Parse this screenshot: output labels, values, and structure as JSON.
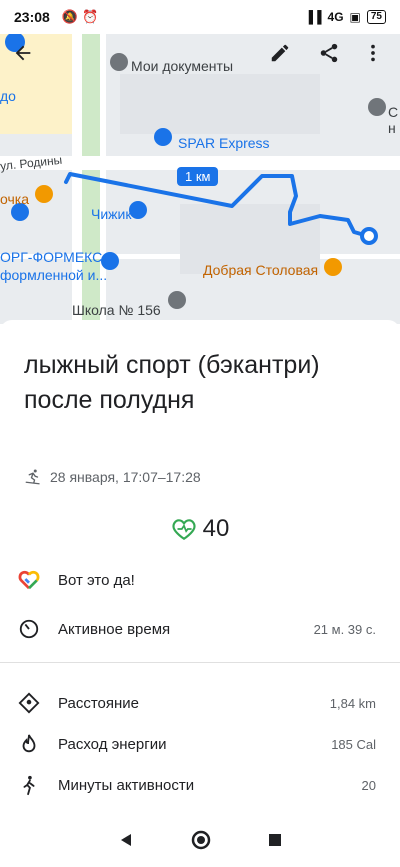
{
  "status_bar": {
    "time": "23:08",
    "network": "4G",
    "battery": "75"
  },
  "map": {
    "labels": {
      "docs": "Мои документы",
      "spar": "SPAR Express",
      "street": "ул. Родины",
      "chizhik": "Чижик",
      "dobraya": "Добрая Столовая",
      "school": "Школа № 156",
      "forms1": "ОРГ-ФОРМЕКС,",
      "forms2": "формленной и...",
      "tochka": "очка",
      "do": "до",
      "right_s": "С",
      "right_n": "н"
    },
    "scale": "1 км"
  },
  "activity": {
    "title": "лыжный спорт (бэкантри) после полудня",
    "date": "28 января, 17:07–17:28",
    "heart_points": "40"
  },
  "stats": [
    {
      "label": "Вот это да!",
      "value": ""
    },
    {
      "label": "Активное время",
      "value": "21 м. 39 с."
    },
    {
      "label": "Расстояние",
      "value": "1,84 km"
    },
    {
      "label": "Расход энергии",
      "value": "185 Cal"
    },
    {
      "label": "Минуты активности",
      "value": "20"
    }
  ],
  "colors": {
    "accent": "#1a73e8",
    "heart": "#34a853"
  }
}
